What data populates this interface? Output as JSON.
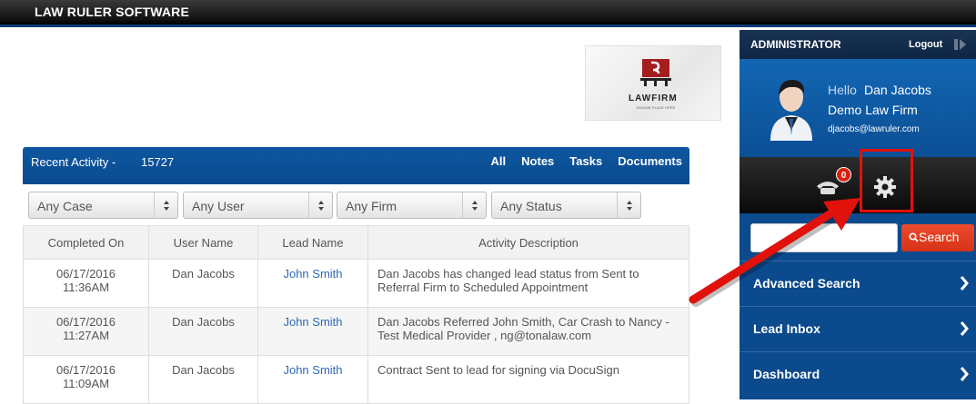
{
  "app": {
    "brand": "LAW RULER SOFTWARE"
  },
  "logo": {
    "name": "LAWFIRM",
    "tagline": "TAGLINE PLACE HERE"
  },
  "recent_activity": {
    "title": "Recent Activity -",
    "count": "15727",
    "filters_links": [
      "All",
      "Notes",
      "Tasks",
      "Documents"
    ]
  },
  "filters": {
    "case": "Any Case",
    "user": "Any User",
    "firm": "Any Firm",
    "status": "Any Status"
  },
  "table": {
    "headers": [
      "Completed On",
      "User Name",
      "Lead Name",
      "Activity Description"
    ],
    "rows": [
      {
        "date": "06/17/2016",
        "time": "11:36AM",
        "user": "Dan Jacobs",
        "lead": "John Smith",
        "desc": "Dan Jacobs has changed lead status from Sent to Referral Firm to Scheduled Appointment"
      },
      {
        "date": "06/17/2016",
        "time": "11:27AM",
        "user": "Dan Jacobs",
        "lead": "John Smith",
        "desc": "Dan Jacobs Referred John Smith, Car Crash to Nancy - Test Medical Provider , ng@tonalaw.com"
      },
      {
        "date": "06/17/2016",
        "time": "11:09AM",
        "user": "Dan Jacobs",
        "lead": "John Smith",
        "desc": "Contract Sent to lead for signing via DocuSign"
      }
    ]
  },
  "sidebar": {
    "role": "ADMINISTRATOR",
    "logout": "Logout",
    "hello": "Hello",
    "user_name": "Dan Jacobs",
    "firm": "Demo Law Firm",
    "email": "djacobs@lawruler.com",
    "phone_badge": "0",
    "search_label": "Search",
    "nav": [
      "Advanced Search",
      "Lead Inbox",
      "Dashboard"
    ]
  },
  "colors": {
    "accent_blue": "#0b4a8c",
    "highlight_red": "#e0120b",
    "search_orange": "#e0401f"
  }
}
